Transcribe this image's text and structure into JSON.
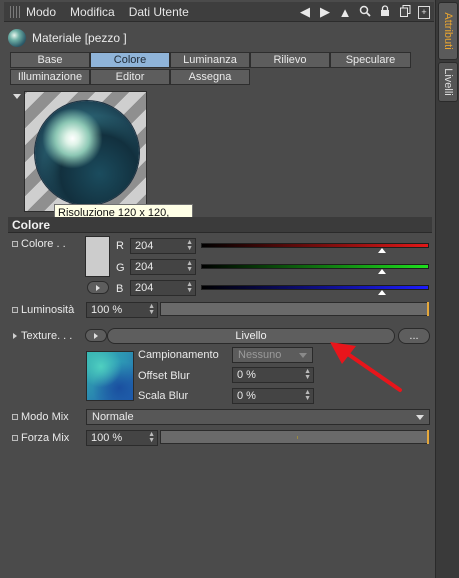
{
  "menubar": {
    "items": [
      "Modo",
      "Modifica",
      "Dati Utente"
    ],
    "icons": [
      "arrow-left-icon",
      "arrow-right-icon",
      "cursor-icon",
      "search-icon",
      "lock-icon",
      "copy-icon",
      "new-panel-icon"
    ]
  },
  "sidebar": {
    "tabs": [
      {
        "label": "Attributi",
        "active": true
      },
      {
        "label": "Livelli",
        "active": false
      }
    ]
  },
  "material": {
    "title": "Materiale [pezzo ]"
  },
  "tabs": {
    "row1": [
      "Base",
      "Colore",
      "Luminanza",
      "Rilievo",
      "Speculare"
    ],
    "row2": [
      "Illuminazione",
      "Editor",
      "Assegna"
    ],
    "active": "Colore"
  },
  "preview": {
    "tooltip": "Risoluzione 120 x 120,"
  },
  "section": {
    "title": "Colore"
  },
  "color": {
    "label": "Colore . .",
    "swatch": "#cccccc",
    "channels": [
      {
        "name": "R",
        "value": "204"
      },
      {
        "name": "G",
        "value": "204"
      },
      {
        "name": "B",
        "value": "204"
      }
    ],
    "level": 0.8
  },
  "luminosity": {
    "label": "Luminosità",
    "value": "100 %"
  },
  "texture": {
    "label": "Texture. . .",
    "button": "Livello",
    "more": "...",
    "sampling_label": "Campionamento",
    "sampling_value": "Nessuno",
    "offset_label": "Offset Blur",
    "offset_value": "0 %",
    "scale_label": "Scala Blur",
    "scale_value": "0 %"
  },
  "mixmode": {
    "label": "Modo Mix",
    "value": "Normale"
  },
  "mixstrength": {
    "label": "Forza Mix",
    "value": "100 %"
  },
  "colors": {
    "active_tab": "#8fb4d9",
    "accent": "#e6a83a",
    "red_arrow": "#e8151b"
  }
}
